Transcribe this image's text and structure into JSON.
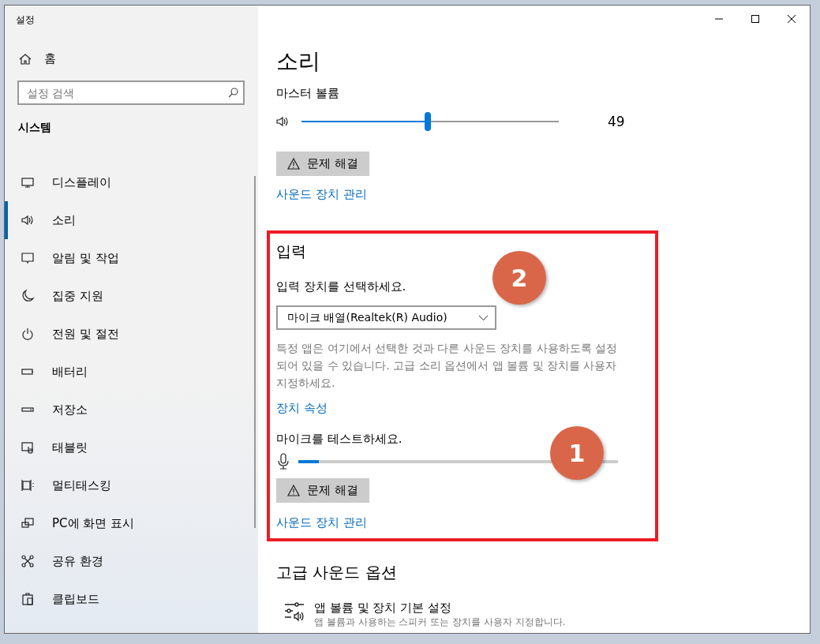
{
  "window": {
    "title": "설정"
  },
  "sidebar": {
    "home": "홈",
    "search": {
      "placeholder": "설정 검색"
    },
    "section": "시스템",
    "items": [
      {
        "kind": "display",
        "label": "디스플레이",
        "selected": false
      },
      {
        "kind": "sound",
        "label": "소리",
        "selected": true
      },
      {
        "kind": "notify",
        "label": "알림 및 작업",
        "selected": false
      },
      {
        "kind": "focus",
        "label": "집중 지원",
        "selected": false
      },
      {
        "kind": "power",
        "label": "전원 및 절전",
        "selected": false
      },
      {
        "kind": "battery",
        "label": "배터리",
        "selected": false
      },
      {
        "kind": "storage",
        "label": "저장소",
        "selected": false
      },
      {
        "kind": "tablet",
        "label": "태블릿",
        "selected": false
      },
      {
        "kind": "multitask",
        "label": "멀티태스킹",
        "selected": false
      },
      {
        "kind": "project",
        "label": "PC에 화면 표시",
        "selected": false
      },
      {
        "kind": "share",
        "label": "공유 환경",
        "selected": false
      },
      {
        "kind": "clipboard",
        "label": "클립보드",
        "selected": false
      }
    ]
  },
  "page": {
    "title": "소리",
    "output": {
      "label": "마스터 볼륨",
      "level": 0.49,
      "reading": "49",
      "troubleshoot": "문제 해결",
      "manage": "사운드 장치 관리"
    },
    "input": {
      "title": "입력",
      "choose_label": "입력 장치를 선택하세요.",
      "device": "마이크 배열(Realtek(R) Audio)",
      "note": "특정 앱은 여기에서 선택한 것과 다른 사운드 장치를 사용하도록 설정되어 있을 수 있습니다. 고급 소리 옵션에서 앱 볼륨 및 장치를 사용자 지정하세요.",
      "properties": "장치 속성",
      "test_label": "마이크를 테스트하세요.",
      "level": 0.065,
      "troubleshoot": "문제 해결",
      "manage": "사운드 장치 관리"
    },
    "advanced": {
      "title": "고급 사운드 옵션",
      "item": {
        "title": "앱 볼륨 및 장치 기본 설정",
        "subtitle": "앱 볼륨과 사용하는 스피커 또는 장치를 사용자 지정합니다."
      }
    }
  },
  "annotations": [
    {
      "label": "2"
    },
    {
      "label": "1"
    }
  ]
}
